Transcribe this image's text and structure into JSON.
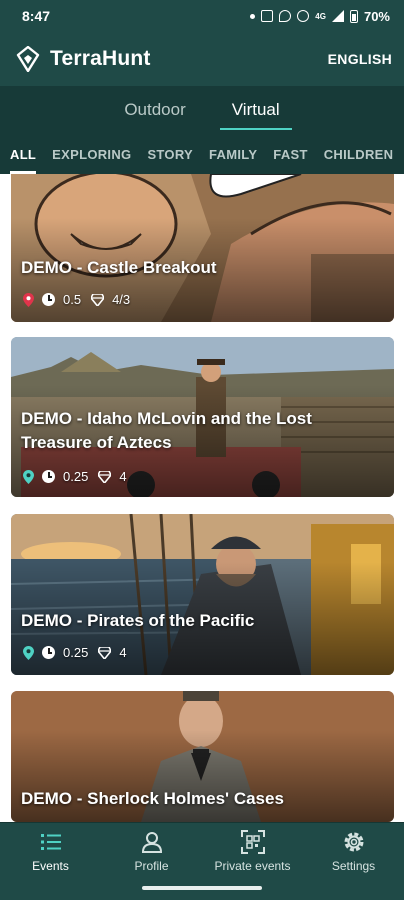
{
  "status_bar": {
    "time": "8:47",
    "network": "4G",
    "battery": "70%"
  },
  "header": {
    "app_name": "TerraHunt",
    "language_label": "ENGLISH"
  },
  "mode_tabs": [
    {
      "label": "Outdoor",
      "active": false
    },
    {
      "label": "Virtual",
      "active": true
    }
  ],
  "category_tabs": [
    {
      "label": "ALL",
      "active": true
    },
    {
      "label": "EXPLORING",
      "active": false
    },
    {
      "label": "STORY",
      "active": false
    },
    {
      "label": "FAMILY",
      "active": false
    },
    {
      "label": "FAST",
      "active": false
    },
    {
      "label": "CHILDREN",
      "active": false
    }
  ],
  "events": [
    {
      "title": "DEMO - Castle Breakout",
      "duration": "0.5",
      "gems": "4/3",
      "pin_color": "#e0344b"
    },
    {
      "title": "DEMO - Idaho McLovin and the Lost Treasure of Aztecs",
      "duration": "0.25",
      "gems": "4",
      "pin_color": "#4fd2c4"
    },
    {
      "title": "DEMO - Pirates of the Pacific",
      "duration": "0.25",
      "gems": "4",
      "pin_color": "#4fd2c4"
    },
    {
      "title": "DEMO - Sherlock Holmes' Cases",
      "duration": "",
      "gems": "",
      "pin_color": "#4fd2c4"
    }
  ],
  "bottom_nav": [
    {
      "label": "Events",
      "icon": "list-icon",
      "active": true
    },
    {
      "label": "Profile",
      "icon": "profile-icon",
      "active": false
    },
    {
      "label": "Private events",
      "icon": "qr-scan-icon",
      "active": false
    },
    {
      "label": "Settings",
      "icon": "gear-icon",
      "active": false
    }
  ],
  "colors": {
    "primary": "#1f4a47",
    "tab_bar": "#173a38",
    "accent": "#4fd2c4"
  }
}
